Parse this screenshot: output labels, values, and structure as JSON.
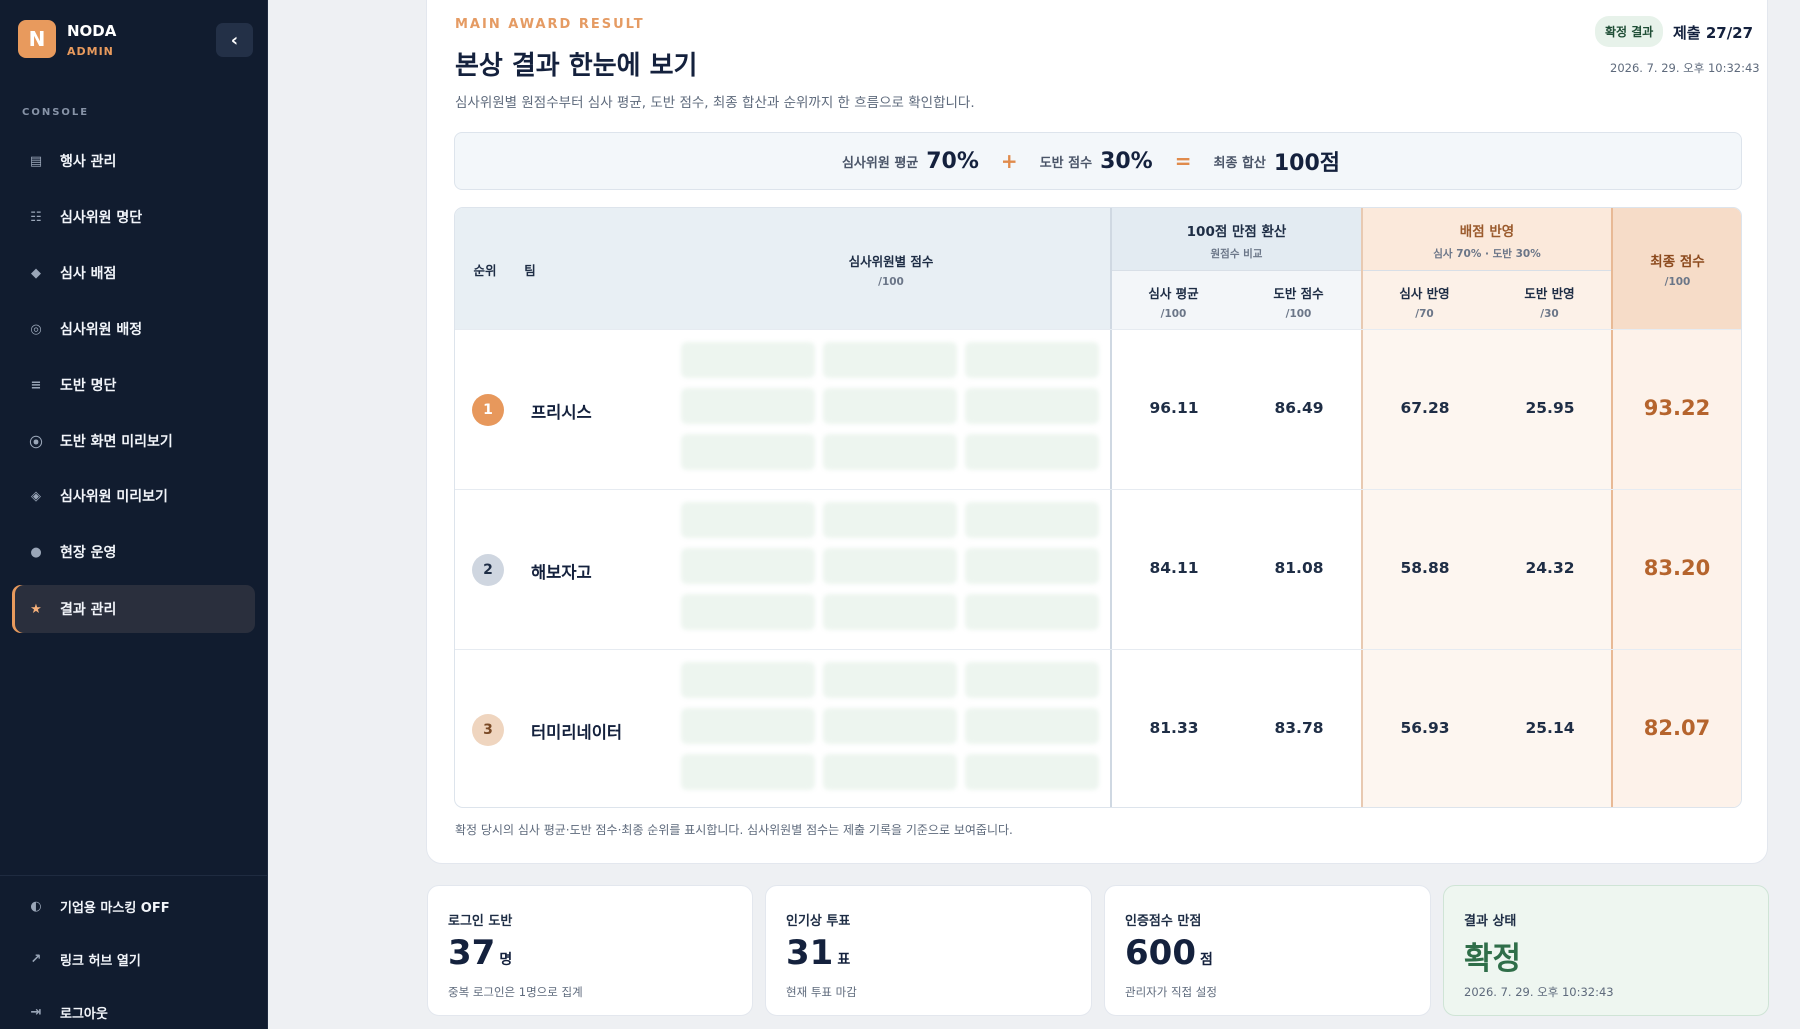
{
  "sidebar": {
    "brand_initial": "N",
    "brand_name": "NODA",
    "brand_sub": "ADMIN",
    "collapse_label": "‹",
    "section_label": "CONSOLE",
    "items": [
      {
        "icon": "calendar-icon",
        "glyph": "▤",
        "label": "행사 관리"
      },
      {
        "icon": "list-icon",
        "glyph": "☷",
        "label": "심사위원 명단"
      },
      {
        "icon": "diamond-icon",
        "glyph": "◆",
        "label": "심사 배점"
      },
      {
        "icon": "target-icon",
        "glyph": "◎",
        "label": "심사위원 배정"
      },
      {
        "icon": "menu-icon",
        "glyph": "≡",
        "label": "도반 명단"
      },
      {
        "icon": "preview-icon",
        "glyph": "⦿",
        "label": "도반 화면 미리보기"
      },
      {
        "icon": "diamond-outline-icon",
        "glyph": "◈",
        "label": "심사위원 미리보기"
      },
      {
        "icon": "circle-icon",
        "glyph": "●",
        "label": "현장 운영"
      },
      {
        "icon": "star-icon",
        "glyph": "★",
        "label": "결과 관리"
      }
    ],
    "footer": [
      {
        "icon": "contrast-icon",
        "glyph": "◐",
        "label": "기업용 마스킹 OFF"
      },
      {
        "icon": "external-link-icon",
        "glyph": "↗",
        "label": "링크 허브 열기"
      },
      {
        "icon": "logout-icon",
        "glyph": "⇥",
        "label": "로그아웃"
      }
    ]
  },
  "header": {
    "eyebrow": "MAIN AWARD RESULT",
    "title": "본상 결과 한눈에 보기",
    "description": "심사위원별 원점수부터 심사 평균, 도반 점수, 최종 합산과 순위까지 한 흐름으로 확인합니다.",
    "status_pill": "확정 결과",
    "submission": "제출 27/27",
    "timestamp": "2026. 7. 29. 오후 10:32:43"
  },
  "formula": {
    "judge_label": "심사위원 평균",
    "judge_value": "70%",
    "plus": "+",
    "doban_label": "도반 점수",
    "doban_value": "30%",
    "equals": "=",
    "total_label": "최종 합산",
    "total_value": "100점"
  },
  "table": {
    "headers": {
      "rank": "순위",
      "team": "팀",
      "judge_scores": "심사위원별 점수",
      "judge_scores_sub": "/100",
      "convert": "100점 만점 환산",
      "convert_sub": "원점수 비교",
      "judge_avg": "심사 평균",
      "judge_avg_sub": "/100",
      "doban_score": "도반 점수",
      "doban_score_sub": "/100",
      "reflect": "배점 반영",
      "reflect_sub": "심사 70% · 도반 30%",
      "judge_reflect": "심사 반영",
      "judge_reflect_sub": "/70",
      "doban_reflect": "도반 반영",
      "doban_reflect_sub": "/30",
      "final": "최종 점수",
      "final_sub": "/100"
    },
    "rows": [
      {
        "rank": "1",
        "team": "프리시스",
        "judge_avg": "96.11",
        "doban": "86.49",
        "judge_reflect": "67.28",
        "doban_reflect": "25.95",
        "final": "93.22"
      },
      {
        "rank": "2",
        "team": "해보자고",
        "judge_avg": "84.11",
        "doban": "81.08",
        "judge_reflect": "58.88",
        "doban_reflect": "24.32",
        "final": "83.20"
      },
      {
        "rank": "3",
        "team": "터미리네이터",
        "judge_avg": "81.33",
        "doban": "83.78",
        "judge_reflect": "56.93",
        "doban_reflect": "25.14",
        "final": "82.07"
      }
    ],
    "footnote": "확정 당시의 심사 평균·도반 점수·최종 순위를 표시합니다. 심사위원별 점수는 제출 기록을 기준으로 보여줍니다."
  },
  "cards": [
    {
      "label": "로그인 도반",
      "value": "37",
      "unit": "명",
      "sub": "중복 로그인은 1명으로 집계"
    },
    {
      "label": "인기상 투표",
      "value": "31",
      "unit": "표",
      "sub": "현재 투표 마감"
    },
    {
      "label": "인증점수 만점",
      "value": "600",
      "unit": "점",
      "sub": "관리자가 직접 설정"
    },
    {
      "label": "결과 상태",
      "value": "확정",
      "unit": "",
      "sub": "2026. 7. 29. 오후 10:32:43"
    }
  ],
  "colors": {
    "accent": "#e89a5d",
    "sidebar_bg": "#111c2f",
    "final_score": "#b5642d",
    "confirmed_green": "#2f6e49"
  }
}
